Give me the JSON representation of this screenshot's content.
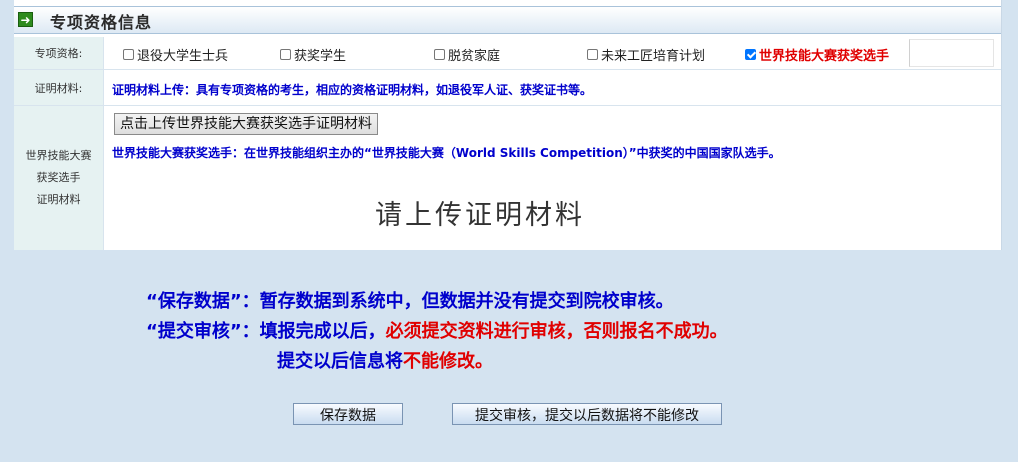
{
  "section": {
    "title": "专项资格信息",
    "icon": "arrow-right-icon"
  },
  "qualification": {
    "label": "专项资格:",
    "options": [
      {
        "label": "退役大学生士兵",
        "checked": false
      },
      {
        "label": "获奖学生",
        "checked": false
      },
      {
        "label": "脱贫家庭",
        "checked": false
      },
      {
        "label": "未来工匠培育计划",
        "checked": false
      },
      {
        "label": "世界技能大赛获奖选手",
        "checked": true
      }
    ]
  },
  "materials": {
    "label": "证明材料:",
    "note": "证明材料上传：具有专项资格的考生，相应的资格证明材料，如退役军人证、获奖证书等。"
  },
  "worldskills": {
    "label_lines": [
      "世界技能大赛",
      "获奖选手",
      "证明材料"
    ],
    "upload_button": "点击上传世界技能大赛获奖选手证明材料",
    "note": "世界技能大赛获奖选手：在世界技能组织主办的“世界技能大赛（World Skills Competition）”中获奖的中国国家队选手。",
    "placeholder": "请上传证明材料"
  },
  "rules": {
    "save_key": "“保存数据”：",
    "save_text": "暂存数据到系统中，但数据并没有提交到院校审核。",
    "submit_key": "“提交审核”：",
    "submit_text_1": "填报完成以后，",
    "submit_text_red": "必须提交资料进行审核，否则报名不成功。",
    "line3_text": "提交以后信息将",
    "line3_red": "不能修改。"
  },
  "buttons": {
    "save": "保存数据",
    "submit": "提交审核，提交以后数据将不能修改"
  },
  "colors": {
    "accent_blue": "#0000cc",
    "alert_red": "#e00000",
    "background": "#d4e3f0"
  }
}
